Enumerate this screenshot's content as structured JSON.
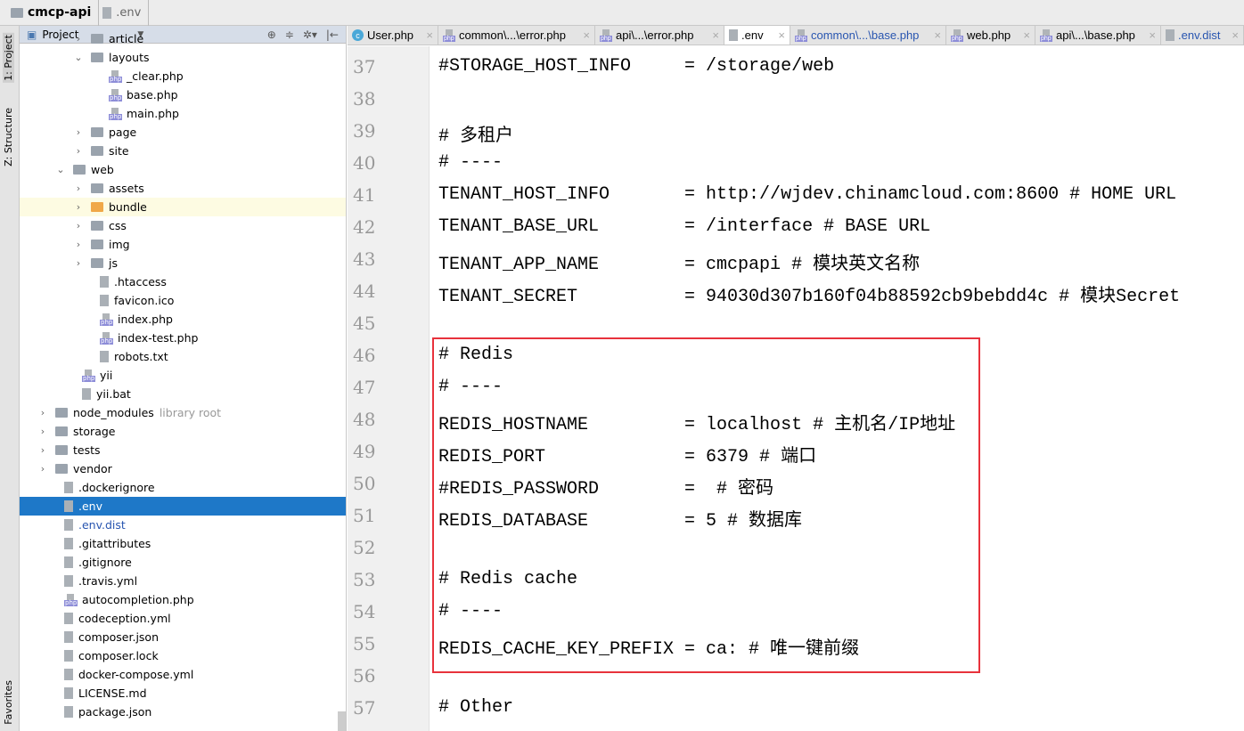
{
  "breadcrumb": {
    "project": "cmcp-api",
    "file": ".env"
  },
  "sidebar_strip": {
    "project": "1: Project",
    "structure": "Z: Structure",
    "favorites": "Favorites"
  },
  "project_panel": {
    "title": "Project",
    "tools": [
      "⊕",
      "≑",
      "✲▾",
      "|←"
    ]
  },
  "tree": [
    {
      "label": "article",
      "depth": 2,
      "type": "folder",
      "chev": "›"
    },
    {
      "label": "layouts",
      "depth": 2,
      "type": "folder",
      "chev": "⌄"
    },
    {
      "label": "_clear.php",
      "depth": 3,
      "type": "php"
    },
    {
      "label": "base.php",
      "depth": 3,
      "type": "php"
    },
    {
      "label": "main.php",
      "depth": 3,
      "type": "php"
    },
    {
      "label": "page",
      "depth": 2,
      "type": "folder",
      "chev": "›"
    },
    {
      "label": "site",
      "depth": 2,
      "type": "folder",
      "chev": "›"
    },
    {
      "label": "web",
      "depth": 1,
      "type": "folder",
      "chev": "⌄"
    },
    {
      "label": "assets",
      "depth": 2,
      "type": "folder",
      "chev": "›"
    },
    {
      "label": "bundle",
      "depth": 2,
      "type": "folder-orange",
      "chev": "›",
      "hl": true
    },
    {
      "label": "css",
      "depth": 2,
      "type": "folder",
      "chev": "›"
    },
    {
      "label": "img",
      "depth": 2,
      "type": "folder",
      "chev": "›"
    },
    {
      "label": "js",
      "depth": 2,
      "type": "folder",
      "chev": "›"
    },
    {
      "label": ".htaccess",
      "depth": 2.5,
      "type": "file"
    },
    {
      "label": "favicon.ico",
      "depth": 2.5,
      "type": "file"
    },
    {
      "label": "index.php",
      "depth": 2.5,
      "type": "php"
    },
    {
      "label": "index-test.php",
      "depth": 2.5,
      "type": "php"
    },
    {
      "label": "robots.txt",
      "depth": 2.5,
      "type": "file"
    },
    {
      "label": "yii",
      "depth": 1.5,
      "type": "php"
    },
    {
      "label": "yii.bat",
      "depth": 1.5,
      "type": "file"
    },
    {
      "label": "node_modules",
      "depth": 0,
      "type": "folder",
      "chev": "›",
      "extra": "library root"
    },
    {
      "label": "storage",
      "depth": 0,
      "type": "folder",
      "chev": "›"
    },
    {
      "label": "tests",
      "depth": 0,
      "type": "folder",
      "chev": "›"
    },
    {
      "label": "vendor",
      "depth": 0,
      "type": "folder",
      "chev": "›"
    },
    {
      "label": ".dockerignore",
      "depth": 0.5,
      "type": "file"
    },
    {
      "label": ".env",
      "depth": 0.5,
      "type": "file",
      "sel": true
    },
    {
      "label": ".env.dist",
      "depth": 0.5,
      "type": "file",
      "blue": true
    },
    {
      "label": ".gitattributes",
      "depth": 0.5,
      "type": "file"
    },
    {
      "label": ".gitignore",
      "depth": 0.5,
      "type": "file"
    },
    {
      "label": ".travis.yml",
      "depth": 0.5,
      "type": "file"
    },
    {
      "label": "autocompletion.php",
      "depth": 0.5,
      "type": "php"
    },
    {
      "label": "codeception.yml",
      "depth": 0.5,
      "type": "file"
    },
    {
      "label": "composer.json",
      "depth": 0.5,
      "type": "file"
    },
    {
      "label": "composer.lock",
      "depth": 0.5,
      "type": "file"
    },
    {
      "label": "docker-compose.yml",
      "depth": 0.5,
      "type": "file"
    },
    {
      "label": "LICENSE.md",
      "depth": 0.5,
      "type": "file"
    },
    {
      "label": "package.json",
      "depth": 0.5,
      "type": "file"
    }
  ],
  "tabs": [
    {
      "label": "User.php",
      "icon": "c"
    },
    {
      "label": "common\\...\\error.php",
      "icon": "php"
    },
    {
      "label": "api\\...\\error.php",
      "icon": "php"
    },
    {
      "label": ".env",
      "icon": "file",
      "active": true
    },
    {
      "label": "common\\...\\base.php",
      "icon": "php",
      "blue": true
    },
    {
      "label": "web.php",
      "icon": "php"
    },
    {
      "label": "api\\...\\base.php",
      "icon": "php"
    },
    {
      "label": ".env.dist",
      "icon": "file",
      "blue": true
    }
  ],
  "editor": {
    "lines": [
      {
        "n": "37",
        "t": "#STORAGE_HOST_INFO     = /storage/web"
      },
      {
        "n": "38",
        "t": ""
      },
      {
        "n": "39",
        "t": "# 多租户"
      },
      {
        "n": "40",
        "t": "# ----"
      },
      {
        "n": "41",
        "t": "TENANT_HOST_INFO       = http://wjdev.chinamcloud.com:8600 # HOME URL"
      },
      {
        "n": "42",
        "t": "TENANT_BASE_URL        = /interface # BASE URL"
      },
      {
        "n": "43",
        "t": "TENANT_APP_NAME        = cmcpapi # 模块英文名称"
      },
      {
        "n": "44",
        "t": "TENANT_SECRET          = 94030d307b160f04b88592cb9bebdd4c # 模块Secret"
      },
      {
        "n": "45",
        "t": ""
      },
      {
        "n": "46",
        "t": "# Redis"
      },
      {
        "n": "47",
        "t": "# ----"
      },
      {
        "n": "48",
        "t": "REDIS_HOSTNAME         = localhost # 主机名/IP地址"
      },
      {
        "n": "49",
        "t": "REDIS_PORT             = 6379 # 端口"
      },
      {
        "n": "50",
        "t": "#REDIS_PASSWORD        =  # 密码"
      },
      {
        "n": "51",
        "t": "REDIS_DATABASE         = 5 # 数据库"
      },
      {
        "n": "52",
        "t": ""
      },
      {
        "n": "53",
        "t": "# Redis cache"
      },
      {
        "n": "54",
        "t": "# ----"
      },
      {
        "n": "55",
        "t": "REDIS_CACHE_KEY_PREFIX = ca: # 唯一键前缀"
      },
      {
        "n": "56",
        "t": ""
      },
      {
        "n": "57",
        "t": "# Other"
      }
    ]
  },
  "colors": {
    "highlight_box": "#e8323c",
    "selection": "#1e78c8"
  }
}
